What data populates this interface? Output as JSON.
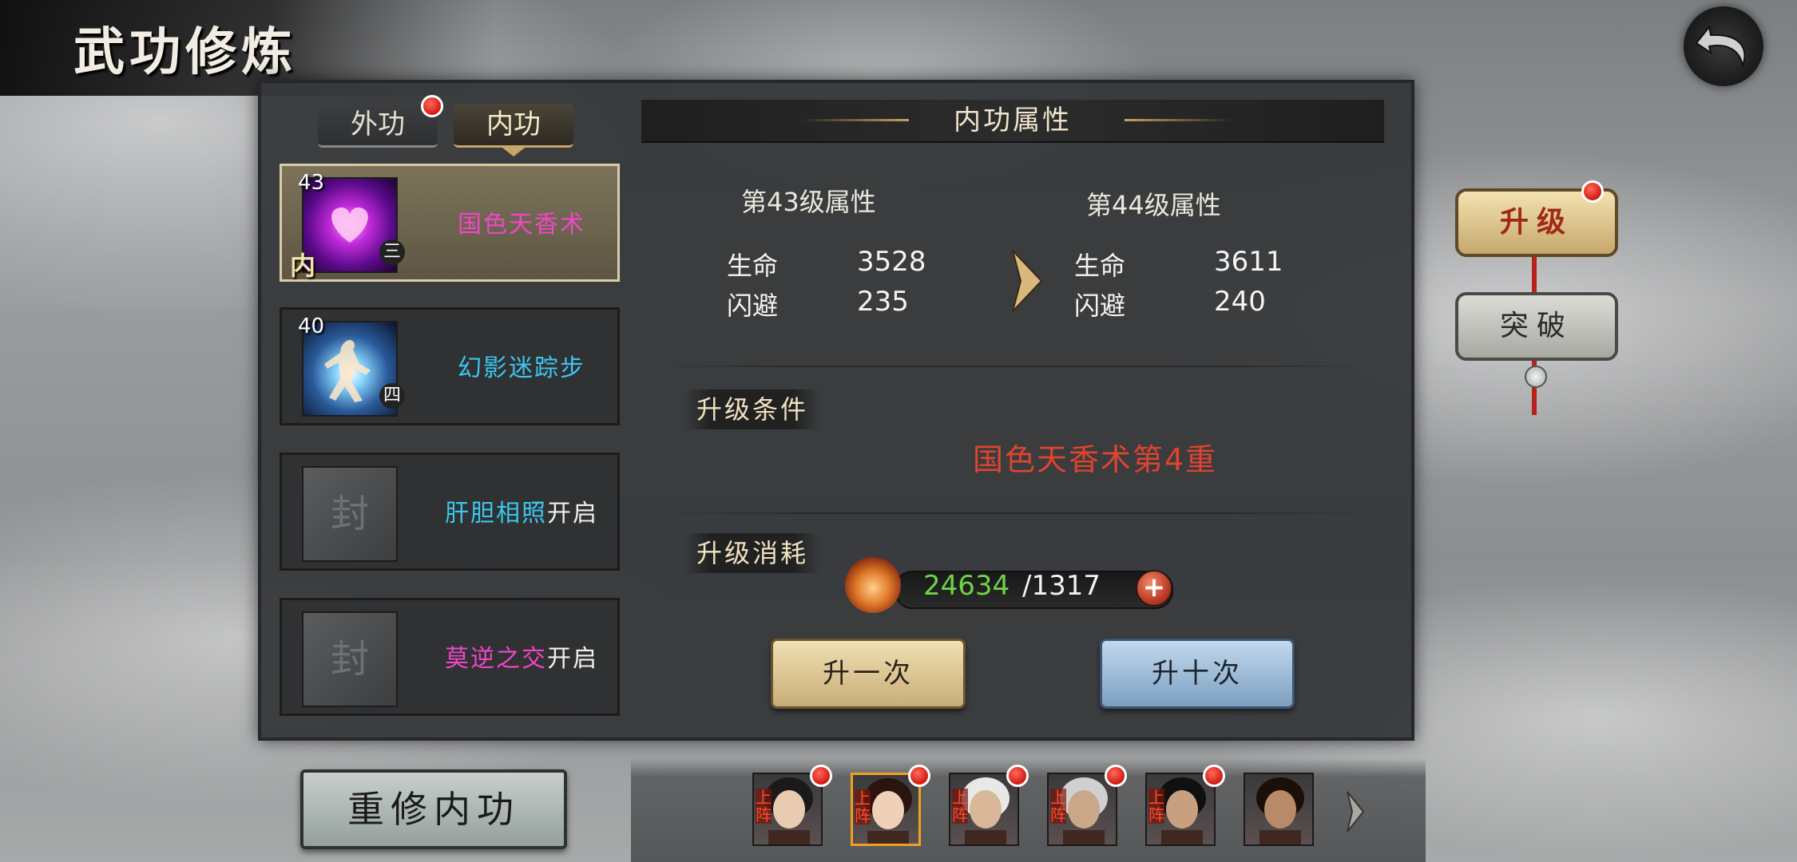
{
  "screen": {
    "title": "武功修炼"
  },
  "tabs": [
    {
      "label": "外功",
      "has_alert": true
    },
    {
      "label": "内功",
      "has_alert": false,
      "selected": true
    }
  ],
  "skills": [
    {
      "level": "43",
      "grade": "三",
      "type_mark": "内",
      "name": "国色天香术",
      "name_color": "#f046c8",
      "locked": false,
      "selected": true
    },
    {
      "level": "40",
      "grade": "四",
      "name": "幻影迷踪步",
      "name_color": "#3cc6f0",
      "locked": false
    },
    {
      "lock_char": "封",
      "name": "肝胆相照",
      "name_color": "#3cc6f0",
      "suffix": "开启",
      "locked": true
    },
    {
      "lock_char": "封",
      "name": "莫逆之交",
      "name_color": "#f046c8",
      "suffix": "开启",
      "locked": true
    }
  ],
  "attributes": {
    "title": "内功属性",
    "current": {
      "heading": "第43级属性",
      "stats": [
        {
          "label": "生命",
          "value": "3528"
        },
        {
          "label": "闪避",
          "value": "235"
        }
      ]
    },
    "next": {
      "heading": "第44级属性",
      "stats": [
        {
          "label": "生命",
          "value": "3611"
        },
        {
          "label": "闪避",
          "value": "240"
        }
      ]
    }
  },
  "upgrade_condition": {
    "label": "升级条件",
    "text": "国色天香术第4重"
  },
  "upgrade_cost": {
    "label": "升级消耗",
    "have": "24634",
    "need": "/1317"
  },
  "buttons": {
    "once": "升一次",
    "ten": "升十次",
    "reforge": "重修内功"
  },
  "side_menu": [
    {
      "label": "升级",
      "has_alert": true,
      "selected": true
    },
    {
      "label": "突破",
      "has_alert": false
    }
  ],
  "heroes": [
    {
      "tag": "上阵",
      "has_alert": true,
      "selected": false,
      "skin": "#e8cbb0",
      "hair": "#1a1a1a"
    },
    {
      "tag": "上阵",
      "has_alert": true,
      "selected": true,
      "skin": "#f0d0b8",
      "hair": "#2a1410"
    },
    {
      "tag": "上阵",
      "has_alert": true,
      "selected": false,
      "skin": "#d8b898",
      "hair": "#e8e8e8"
    },
    {
      "tag": "上阵",
      "has_alert": true,
      "selected": false,
      "skin": "#c8a888",
      "hair": "#d0d0d0"
    },
    {
      "tag": "上阵",
      "has_alert": true,
      "selected": false,
      "skin": "#c8a080",
      "hair": "#101010"
    },
    {
      "tag": "",
      "has_alert": false,
      "selected": false,
      "skin": "#b88a68",
      "hair": "#1a1008"
    }
  ]
}
